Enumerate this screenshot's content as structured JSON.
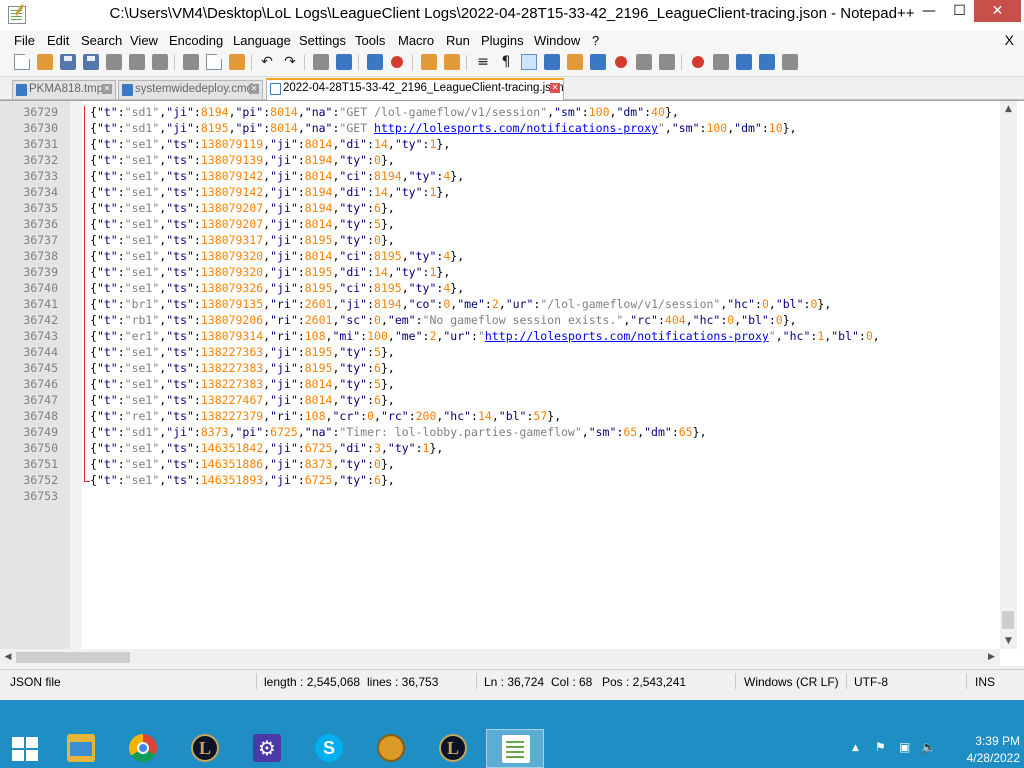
{
  "window": {
    "title": "C:\\Users\\VM4\\Desktop\\LoL Logs\\LeagueClient Logs\\2022-04-28T15-33-42_2196_LeagueClient-tracing.json - Notepad++",
    "minimize": "—",
    "maximize": "☐",
    "close": "✕"
  },
  "menu": {
    "items": [
      "File",
      "Edit",
      "Search",
      "View",
      "Encoding",
      "Language",
      "Settings",
      "Tools",
      "Macro",
      "Run",
      "Plugins",
      "Window",
      "?"
    ],
    "close_doc": "X"
  },
  "tabs": [
    {
      "label": "PKMA818.tmp",
      "active": false
    },
    {
      "label": "systemwidedeploy.cmd",
      "active": false
    },
    {
      "label": "2022-04-28T15-33-42_2196_LeagueClient-tracing.json",
      "active": true
    }
  ],
  "editor": {
    "line_numbers": [
      "36729",
      "36730",
      "36731",
      "36732",
      "36733",
      "36734",
      "36735",
      "36736",
      "36737",
      "36738",
      "36739",
      "36740",
      "36741",
      "36742",
      "36743",
      "36744",
      "36745",
      "36746",
      "36747",
      "36748",
      "36749",
      "36750",
      "36751",
      "36752",
      "36753"
    ],
    "lines": [
      "{\"t\":\"sd1\",\"ji\":8194,\"pi\":8014,\"na\":\"GET /lol-gameflow/v1/session\",\"sm\":100,\"dm\":40},",
      "{\"t\":\"sd1\",\"ji\":8195,\"pi\":8014,\"na\":\"GET http://lolesports.com/notifications-proxy\",\"sm\":100,\"dm\":10},",
      "{\"t\":\"se1\",\"ts\":138079119,\"ji\":8014,\"di\":14,\"ty\":1},",
      "{\"t\":\"se1\",\"ts\":138079139,\"ji\":8194,\"ty\":0},",
      "{\"t\":\"se1\",\"ts\":138079142,\"ji\":8014,\"ci\":8194,\"ty\":4},",
      "{\"t\":\"se1\",\"ts\":138079142,\"ji\":8194,\"di\":14,\"ty\":1},",
      "{\"t\":\"se1\",\"ts\":138079207,\"ji\":8194,\"ty\":6},",
      "{\"t\":\"se1\",\"ts\":138079207,\"ji\":8014,\"ty\":5},",
      "{\"t\":\"se1\",\"ts\":138079317,\"ji\":8195,\"ty\":0},",
      "{\"t\":\"se1\",\"ts\":138079320,\"ji\":8014,\"ci\":8195,\"ty\":4},",
      "{\"t\":\"se1\",\"ts\":138079320,\"ji\":8195,\"di\":14,\"ty\":1},",
      "{\"t\":\"se1\",\"ts\":138079326,\"ji\":8195,\"ci\":8195,\"ty\":4},",
      "{\"t\":\"br1\",\"ts\":138079135,\"ri\":2601,\"ji\":8194,\"co\":0,\"me\":2,\"ur\":\"/lol-gameflow/v1/session\",\"hc\":0,\"bl\":0},",
      "{\"t\":\"rb1\",\"ts\":138079206,\"ri\":2601,\"sc\":0,\"em\":\"No gameflow session exists.\",\"rc\":404,\"hc\":0,\"bl\":0},",
      "{\"t\":\"er1\",\"ts\":138079314,\"ri\":108,\"mi\":100,\"me\":2,\"ur\":\"http://lolesports.com/notifications-proxy\",\"hc\":1,\"bl\":0,",
      "{\"t\":\"se1\",\"ts\":138227363,\"ji\":8195,\"ty\":5},",
      "{\"t\":\"se1\",\"ts\":138227383,\"ji\":8195,\"ty\":6},",
      "{\"t\":\"se1\",\"ts\":138227383,\"ji\":8014,\"ty\":5},",
      "{\"t\":\"se1\",\"ts\":138227467,\"ji\":8014,\"ty\":6},",
      "{\"t\":\"re1\",\"ts\":138227379,\"ri\":108,\"cr\":0,\"rc\":200,\"hc\":14,\"bl\":57},",
      "{\"t\":\"sd1\",\"ji\":8373,\"pi\":6725,\"na\":\"Timer: lol-lobby.parties-gameflow\",\"sm\":65,\"dm\":65},",
      "{\"t\":\"se1\",\"ts\":146351842,\"ji\":6725,\"di\":3,\"ty\":1},",
      "{\"t\":\"se1\",\"ts\":146351886,\"ji\":8373,\"ty\":0},",
      "{\"t\":\"se1\",\"ts\":146351893,\"ji\":6725,\"ty\":6},",
      ""
    ]
  },
  "status": {
    "file_type": "JSON file",
    "length": "length : 2,545,068",
    "lines": "lines : 36,753",
    "ln": "Ln : 36,724",
    "col": "Col : 68",
    "pos": "Pos : 2,543,241",
    "eol": "Windows (CR LF)",
    "encoding": "UTF-8",
    "mode": "INS"
  },
  "taskbar": {
    "apps": [
      {
        "icon": "file-explorer-icon",
        "label": ""
      },
      {
        "icon": "chrome-icon",
        "label": ""
      },
      {
        "icon": "league-client-icon",
        "label": "L"
      },
      {
        "icon": "settings-gear-icon",
        "label": "⚙"
      },
      {
        "icon": "skype-icon",
        "label": "S"
      },
      {
        "icon": "app-icon",
        "label": ""
      },
      {
        "icon": "league-of-legends-icon",
        "label": "L"
      },
      {
        "icon": "notepadpp-icon",
        "label": ""
      }
    ],
    "tray": {
      "chevron": "▲",
      "flag": "⚑",
      "network": "▣",
      "volume": "🔈"
    },
    "time": "3:39 PM",
    "date": "4/28/2022"
  }
}
